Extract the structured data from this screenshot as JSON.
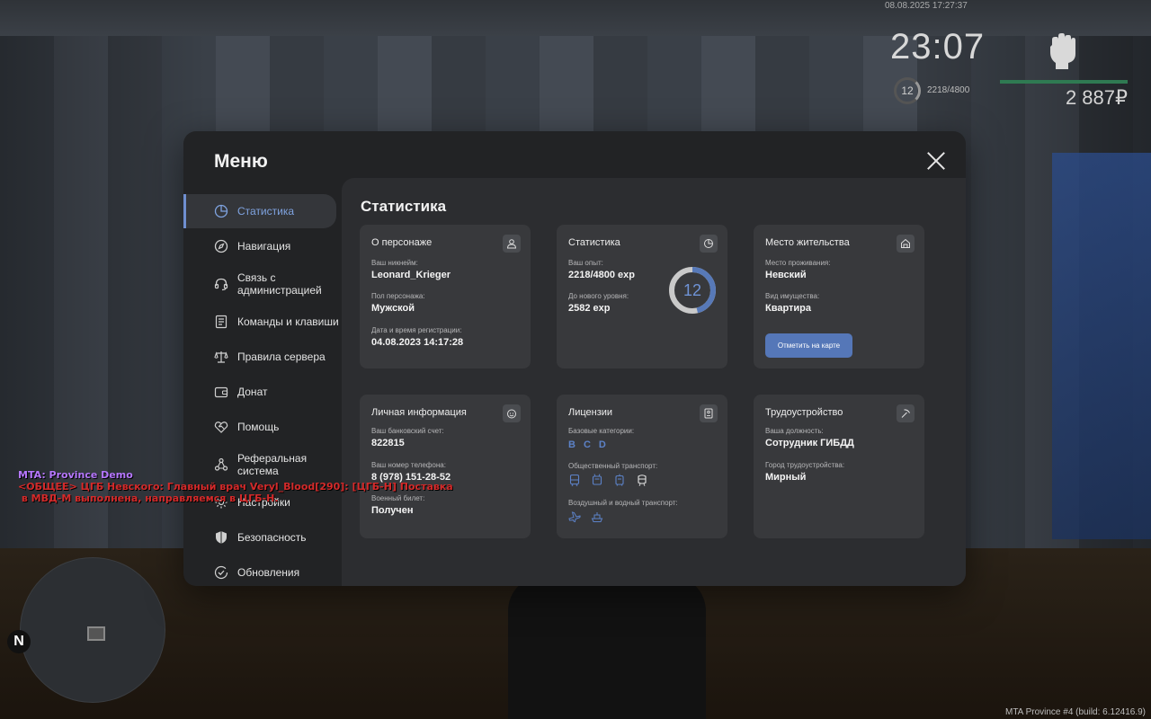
{
  "hud": {
    "datetime": "08.08.2025 17:27:37",
    "time": "23:07",
    "level": "12",
    "exp": "2218/4800",
    "money": "2 887₽"
  },
  "chat": {
    "lines": [
      "MTA: Province Demo",
      "<ОБЩЕЕ> ЦГБ Невского: Главный врач Veryl_Blood[290]: [ЦГБ-Н] Поставка",
      " в МВД-М выполнена, направляемся в ЦГБ-Н."
    ]
  },
  "minimap": {
    "north": "N"
  },
  "build": "MTA Province #4 (build: 6.12416.9)",
  "modal": {
    "title": "Меню",
    "sidebar": [
      {
        "label": "Статистика",
        "icon": "pie-chart-icon",
        "active": true
      },
      {
        "label": "Навигация",
        "icon": "compass-icon"
      },
      {
        "label": "Связь с администрацией",
        "icon": "headset-icon"
      },
      {
        "label": "Команды и клавиши",
        "icon": "keyboard-icon"
      },
      {
        "label": "Правила сервера",
        "icon": "scales-icon"
      },
      {
        "label": "Донат",
        "icon": "wallet-icon"
      },
      {
        "label": "Помощь",
        "icon": "handshake-icon"
      },
      {
        "label": "Реферальная система",
        "icon": "referral-icon"
      },
      {
        "label": "Настройки",
        "icon": "gear-icon"
      },
      {
        "label": "Безопасность",
        "icon": "shield-icon"
      },
      {
        "label": "Обновления",
        "icon": "check-circle-icon"
      }
    ],
    "content_title": "Статистика",
    "cards": {
      "character": {
        "title": "О персонаже",
        "nickname_label": "Ваш никнейм:",
        "nickname": "Leonard_Krieger",
        "gender_label": "Пол персонажа:",
        "gender": "Мужской",
        "reg_label": "Дата и время регистрации:",
        "reg": "04.08.2023 14:17:28"
      },
      "stats": {
        "title": "Статистика",
        "exp_label": "Ваш опыт:",
        "exp": "2218/4800 exp",
        "next_label": "До нового уровня:",
        "next": "2582 exp",
        "level": "12",
        "progress": 0.462
      },
      "residence": {
        "title": "Место жительства",
        "place_label": "Место проживания:",
        "place": "Невский",
        "property_label": "Вид имущества:",
        "property": "Квартира",
        "button": "Отметить на карте"
      },
      "personal": {
        "title": "Личная информация",
        "bank_label": "Ваш банковский счет:",
        "bank": "822815",
        "phone_label": "Ваш номер телефона:",
        "phone": "8 (978) 151-28-52",
        "military_label": "Военный билет:",
        "military": "Получен"
      },
      "licenses": {
        "title": "Лицензии",
        "basic_label": "Базовые категории:",
        "categories": [
          "B",
          "C",
          "D"
        ],
        "public_label": "Общественный транспорт:",
        "public_icons": [
          "bus-icon",
          "trolleybus-icon",
          "tram-icon",
          "metro-icon"
        ],
        "air_label": "Воздушный и водный транспорт:",
        "air_icons": [
          "airplane-icon",
          "boat-icon"
        ]
      },
      "job": {
        "title": "Трудоустройство",
        "position_label": "Ваша должность:",
        "position": "Сотрудник ГИБДД",
        "city_label": "Город трудоустройства:",
        "city": "Мирный"
      }
    }
  }
}
